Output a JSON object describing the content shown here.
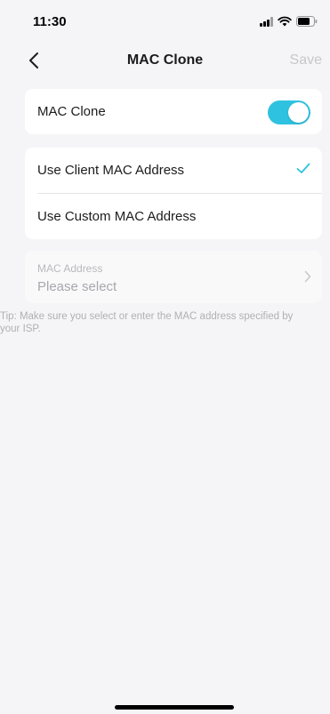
{
  "status_bar": {
    "time": "11:30",
    "icons": [
      "signal-icon",
      "wifi-icon",
      "battery-icon"
    ]
  },
  "nav": {
    "back_icon": "chevron-left-icon",
    "title": "MAC Clone",
    "save_label": "Save"
  },
  "mac_clone_toggle": {
    "label": "MAC Clone",
    "enabled": true
  },
  "options": [
    {
      "label": "Use Client MAC Address",
      "selected": true
    },
    {
      "label": "Use Custom MAC Address",
      "selected": false
    }
  ],
  "mac_address_field": {
    "label": "MAC Address",
    "placeholder": "Please select"
  },
  "tip": "Tip: Make sure you select or enter the MAC address specified by your ISP.",
  "colors": {
    "accent": "#2ec2e0",
    "background": "#f5f5f7",
    "card": "#ffffff",
    "disabled_text": "#c7c7cc",
    "hint_text": "#b0b0b5"
  }
}
